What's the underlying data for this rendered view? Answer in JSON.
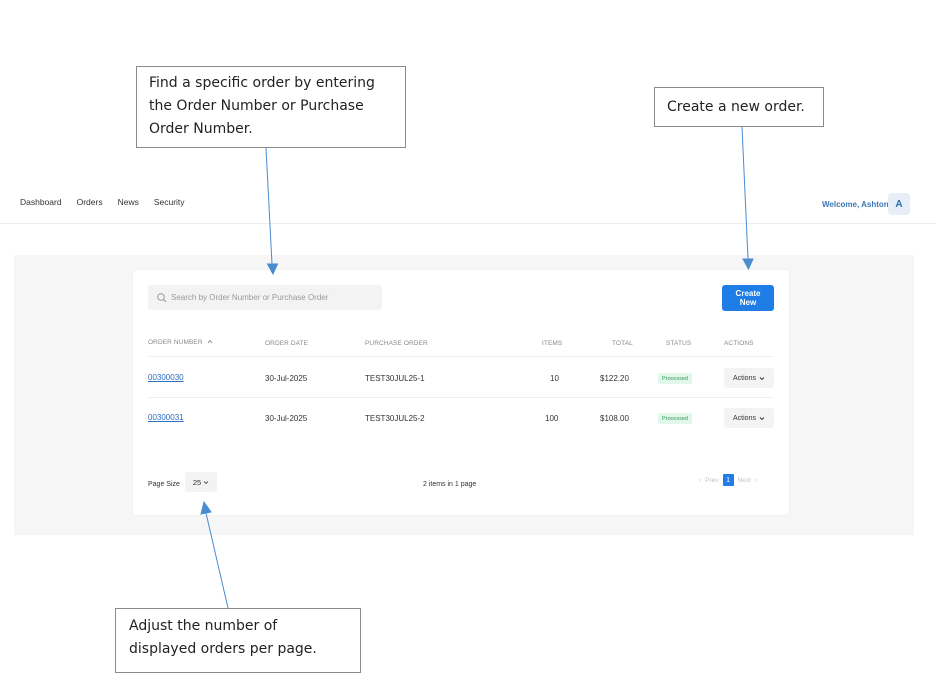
{
  "callouts": {
    "search": "Find a specific order by entering the Order Number or Purchase Order Number.",
    "create": "Create a new order.",
    "page_size": "Adjust the number of displayed orders per page."
  },
  "nav": {
    "items": [
      "Dashboard",
      "Orders",
      "News",
      "Security"
    ],
    "welcome": "Welcome, Ashton",
    "avatar": "A"
  },
  "search": {
    "placeholder": "Search by Order Number or Purchase Order"
  },
  "toolbar": {
    "create_label": "Create New"
  },
  "table": {
    "headers": {
      "order_number": "ORDER NUMBER",
      "order_date": "ORDER DATE",
      "purchase_order": "PURCHASE ORDER",
      "items": "ITEMS",
      "total": "TOTAL",
      "status": "STATUS",
      "actions": "ACTIONS"
    },
    "sort_icon": "chevron-up-icon",
    "rows": [
      {
        "order_number": "00300030",
        "order_date": "30-Jul-2025",
        "purchase_order": "TEST30JUL25-1",
        "items": "10",
        "total": "$122.20",
        "status": "Processed",
        "actions": "Actions"
      },
      {
        "order_number": "00300031",
        "order_date": "30-Jul-2025",
        "purchase_order": "TEST30JUL25-2",
        "items": "100",
        "total": "$108.00",
        "status": "Processed",
        "actions": "Actions"
      }
    ]
  },
  "footer": {
    "page_size_label": "Page Size",
    "page_size_value": "25",
    "items_info": "2 items in 1 page",
    "prev": "Prev",
    "current_page": "1",
    "next": "Next"
  },
  "colors": {
    "accent": "#1f7de6",
    "status_processed_bg": "#e3f6ea",
    "status_processed_text": "#2b9a55",
    "link": "#2a6fc1",
    "arrow": "#4a8cd0"
  }
}
